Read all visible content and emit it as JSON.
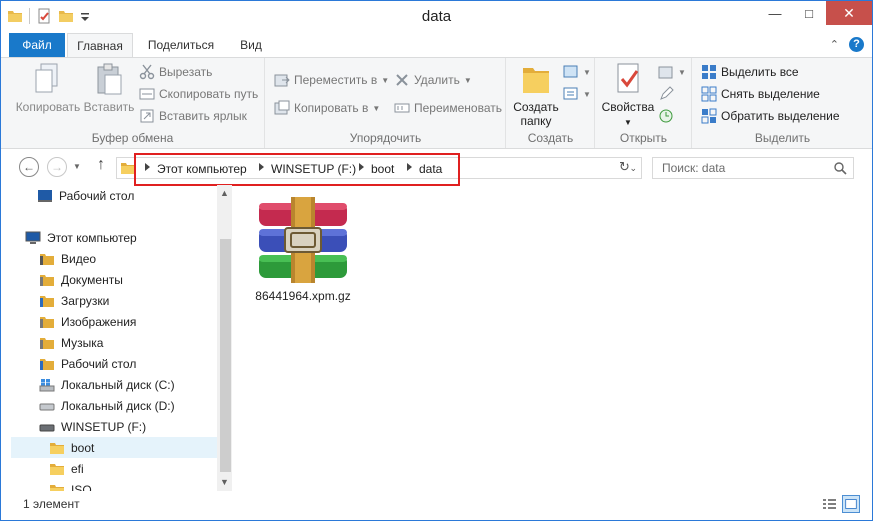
{
  "window": {
    "title": "data"
  },
  "tabs": {
    "file": "Файл",
    "home": "Главная",
    "share": "Поделиться",
    "view": "Вид"
  },
  "ribbon": {
    "clipboard": {
      "label": "Буфер обмена",
      "copy": "Копировать",
      "paste": "Вставить",
      "cut": "Вырезать",
      "copy_path": "Скопировать путь",
      "paste_shortcut": "Вставить ярлык"
    },
    "organize": {
      "label": "Упорядочить",
      "move_to": "Переместить в",
      "copy_to": "Копировать в",
      "delete": "Удалить",
      "rename": "Переименовать"
    },
    "new": {
      "label": "Создать",
      "new_folder_line1": "Создать",
      "new_folder_line2": "папку"
    },
    "open": {
      "label": "Открыть",
      "properties": "Свойства"
    },
    "select": {
      "label": "Выделить",
      "select_all": "Выделить все",
      "select_none": "Снять выделение",
      "invert": "Обратить выделение"
    }
  },
  "address": {
    "crumbs": [
      "Этот компьютер",
      "WINSETUP (F:)",
      "boot",
      "data"
    ],
    "search_placeholder": "Поиск: data"
  },
  "nav_pane": {
    "items": [
      {
        "label": "Рабочий стол",
        "icon": "desktop-icon"
      },
      {
        "label": "Этот компьютер",
        "icon": "computer-icon"
      },
      {
        "label": "Видео",
        "icon": "video-folder-icon"
      },
      {
        "label": "Документы",
        "icon": "documents-folder-icon"
      },
      {
        "label": "Загрузки",
        "icon": "downloads-folder-icon"
      },
      {
        "label": "Изображения",
        "icon": "pictures-folder-icon"
      },
      {
        "label": "Музыка",
        "icon": "music-folder-icon"
      },
      {
        "label": "Рабочий стол",
        "icon": "desktop-folder-icon"
      },
      {
        "label": "Локальный диск (C:)",
        "icon": "windows-drive-icon"
      },
      {
        "label": "Локальный диск (D:)",
        "icon": "drive-icon"
      },
      {
        "label": "WINSETUP (F:)",
        "icon": "usb-drive-icon"
      },
      {
        "label": "boot",
        "icon": "folder-icon"
      },
      {
        "label": "efi",
        "icon": "folder-icon"
      },
      {
        "label": "ISO",
        "icon": "folder-icon"
      }
    ]
  },
  "content": {
    "files": [
      {
        "name": "86441964.xpm.gz",
        "icon": "winrar-archive-icon"
      }
    ]
  },
  "status": {
    "count": "1 элемент"
  },
  "colors": {
    "file_tab": "#1979ca",
    "close_button": "#c7504b",
    "highlight": "#e02020",
    "selection": "#e5f3fb"
  }
}
